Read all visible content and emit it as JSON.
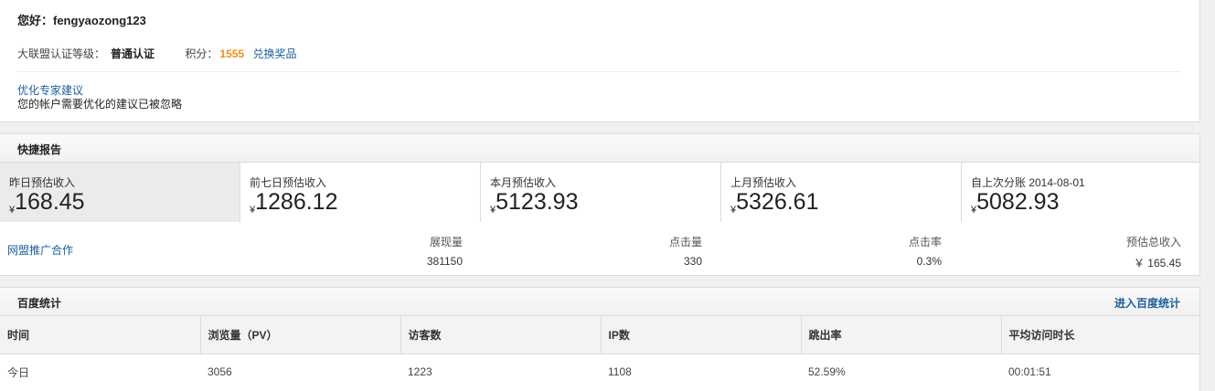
{
  "greeting": "您好：fengyaozong123",
  "cert": {
    "label": "大联盟认证等级：",
    "level": "普通认证",
    "points_label": "积分：",
    "points": "1555",
    "redeem": "兑换奖品"
  },
  "advice": {
    "link": "优化专家建议",
    "text": "您的帐户需要优化的建议已被忽略"
  },
  "quick_report": {
    "title": "快捷报告",
    "stats": [
      {
        "label": "昨日预估收入",
        "currency": "¥",
        "value": "168.45"
      },
      {
        "label": "前七日预估收入",
        "currency": "¥",
        "value": "1286.12"
      },
      {
        "label": "本月预估收入",
        "currency": "¥",
        "value": "5123.93"
      },
      {
        "label": "上月预估收入",
        "currency": "¥",
        "value": "5326.61"
      },
      {
        "label": "自上次分账 2014-08-01",
        "currency": "¥",
        "value": "5082.93"
      }
    ],
    "union": {
      "link": "网盟推广合作",
      "columns": [
        {
          "label": "展现量",
          "value": "381150"
        },
        {
          "label": "点击量",
          "value": "330"
        },
        {
          "label": "点击率",
          "value": "0.3%"
        },
        {
          "label": "预估总收入",
          "value": "￥ 165.45"
        }
      ]
    }
  },
  "baidu_stats": {
    "title": "百度统计",
    "enter_link": "进入百度统计",
    "headers": [
      "时间",
      "浏览量（PV）",
      "访客数",
      "IP数",
      "跳出率",
      "平均访问时长"
    ],
    "rows": [
      [
        "今日",
        "3056",
        "1223",
        "1108",
        "52.59%",
        "00:01:51"
      ]
    ]
  },
  "colors": {
    "link": "#1a5e9c",
    "points": "#e8911e",
    "active_stat_bg": "#ebebeb"
  }
}
